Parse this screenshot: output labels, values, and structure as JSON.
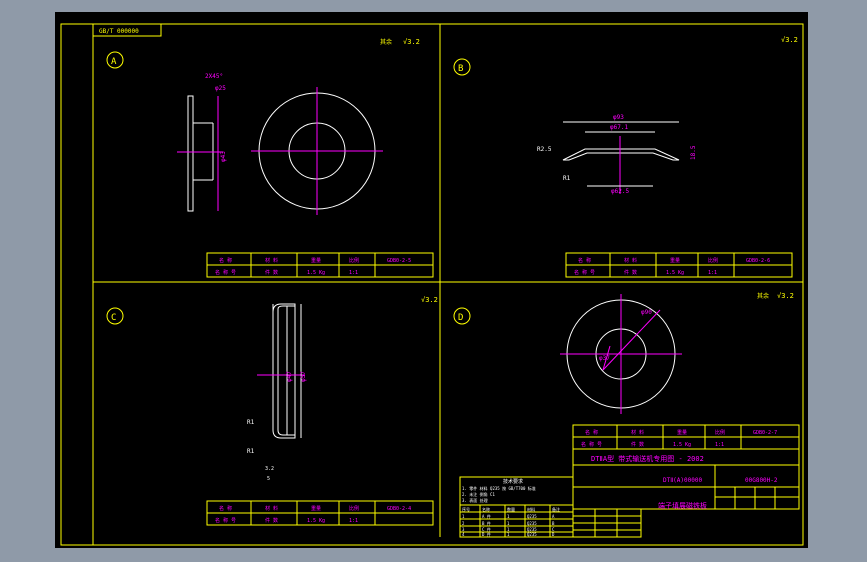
{
  "sheet": {
    "code_box": "GB/T 000000",
    "title_line": "DTⅡA型 带式输送机专用图 - 2002",
    "doc_code": "DTⅡ(A)00000",
    "drawing_no": "00G800H-2",
    "part_name": "端子填展磁铁板",
    "roughness_note": "其余"
  },
  "views": [
    {
      "label": "A",
      "roughness": "√3.2",
      "note_size": "2X45°",
      "dim_1": "φ25",
      "dim_2": "φ43"
    },
    {
      "label": "B",
      "roughness": "√3.2",
      "dim_top": "φ93",
      "dim_mid": "φ67.1",
      "dim_left": "R2.5",
      "dim_left2": "R1",
      "dim_bottom": "φ62.5",
      "dim_right": "18.5"
    },
    {
      "label": "C",
      "roughness": "√3.2",
      "dim_1": "φ47",
      "dim_2": "φ57",
      "dim_r1": "R1",
      "dim_r2": "R1",
      "dim_bottom": "3.2",
      "dim_bottom2": "5"
    },
    {
      "label": "D",
      "roughness": "√3.2",
      "dim_1": "φ90",
      "dim_2": "φ37"
    }
  ],
  "mini_tables": [
    {
      "row1": [
        "名 称",
        "材 料",
        "重量",
        "比例",
        "GDB0-2-5"
      ],
      "row2": [
        "名 称 号",
        "件 数",
        "1.5 Kg",
        "1:1",
        ""
      ]
    },
    {
      "row1": [
        "名 称",
        "材 料",
        "重量",
        "比例",
        "GDB0-2-6"
      ],
      "row2": [
        "名 称 号",
        "件 数",
        "1.5 Kg",
        "1:1",
        ""
      ]
    },
    {
      "row1": [
        "名 称",
        "材 料",
        "重量",
        "比例",
        "GDB0-2-4"
      ],
      "row2": [
        "名 称 号",
        "件 数",
        "1.5 Kg",
        "1:1",
        ""
      ]
    },
    {
      "row1": [
        "名 称",
        "材 料",
        "重量",
        "比例",
        "GDB0-2-7"
      ],
      "row2": [
        "名 称 号",
        "件 数",
        "1.5 Kg",
        "1:1",
        ""
      ]
    }
  ],
  "tech_table": {
    "title": "技术要求",
    "lines": [
      "1. 零件 材料 Q235 按 GB/T700 标准",
      "2. 未注 倒角 C1",
      "3. 表面 处理"
    ],
    "grid": [
      [
        "序号",
        "名称",
        "数量",
        "材料",
        "备注"
      ],
      [
        "1",
        "A 件",
        "1",
        "Q235",
        "A"
      ],
      [
        "2",
        "B 件",
        "1",
        "Q235",
        "B"
      ],
      [
        "3",
        "C 件",
        "1",
        "Q235",
        "C"
      ],
      [
        "4",
        "D 件",
        "1",
        "Q235",
        "D"
      ]
    ]
  },
  "colors": {
    "sheet": "#000000",
    "frame": "#ffff00",
    "geometry": "#ffffff",
    "dims": "#ff00ff",
    "center": "#ff00ff",
    "table": "#ffff00",
    "bg": "#8f9aa8"
  }
}
